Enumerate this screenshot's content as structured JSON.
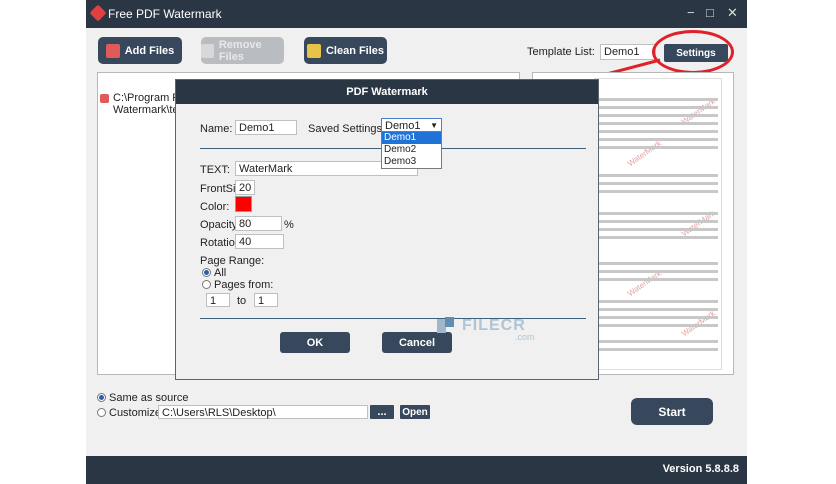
{
  "window": {
    "title": "Free PDF Watermark",
    "minimize": "−",
    "maximize": "□",
    "close": "✕"
  },
  "toolbar": {
    "add_files": "Add Files",
    "remove_files": "Remove Files",
    "clean_files": "Clean Files",
    "template_label": "Template List:",
    "template_value": "Demo1",
    "settings": "Settings"
  },
  "file_list": {
    "line1": "C:\\Program Files",
    "line2": "Watermark\\tem"
  },
  "dialog": {
    "title": "PDF Watermark",
    "name_label": "Name:",
    "name_value": "Demo1",
    "saved_label": "Saved Settings:",
    "saved_value": "Demo1",
    "options": [
      "Demo1",
      "Demo2",
      "Demo3"
    ],
    "text_label": "TEXT:",
    "text_value": "WaterMark",
    "fontsize_label": "FrontSize",
    "fontsize_value": "20",
    "color_label": "Color:",
    "color_value": "#ff0000",
    "opacity_label": "Opacity:",
    "opacity_value": "80",
    "opacity_unit": "%",
    "rotation_label": "Rotation:",
    "rotation_value": "40",
    "page_range_label": "Page Range:",
    "all_label": "All",
    "pages_from_label": "Pages from:",
    "from_value": "1",
    "to_label": "to",
    "to_value": "1",
    "ok": "OK",
    "cancel": "Cancel"
  },
  "output": {
    "same_as_source": "Same as source",
    "customize": "Customize",
    "path": "C:\\Users\\RLS\\Desktop\\",
    "browse": "...",
    "open": "Open",
    "start": "Start"
  },
  "footer": {
    "version": "Version 5.8.8.8"
  },
  "watermark_text": "FILECR",
  "watermark_sub": ".com",
  "preview_watermark": "WaterMark",
  "colors": {
    "accent": "#37485c",
    "titlebar": "#2b3644",
    "highlight": "#e0202a"
  }
}
